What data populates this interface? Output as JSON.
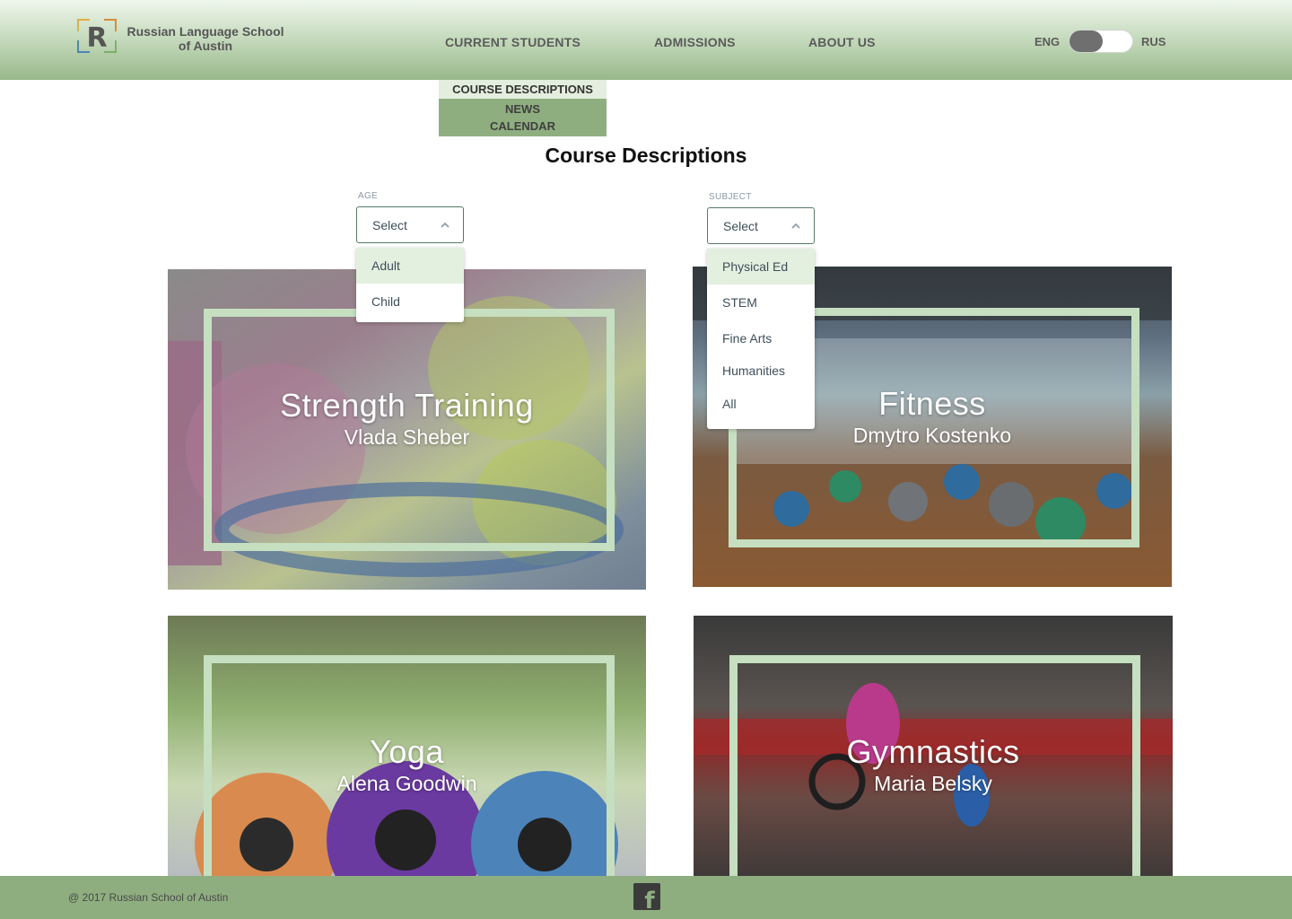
{
  "header": {
    "logo_letter": "R",
    "school_name_line1": "Russian Language School",
    "school_name_line2": "of Austin",
    "nav": {
      "current_students": "CURRENT STUDENTS",
      "admissions": "ADMISSIONS",
      "about_us": "ABOUT US"
    },
    "lang_eng": "ENG",
    "lang_rus": "RUS"
  },
  "submenu": {
    "items": [
      "COURSE DESCRIPTIONS",
      "NEWS",
      "CALENDAR"
    ]
  },
  "page_title": "Course Descriptions",
  "filters": {
    "age": {
      "label": "AGE",
      "value": "Select",
      "options": [
        "Adult",
        "Child"
      ]
    },
    "subject": {
      "label": "SUBJECT",
      "value": "Select",
      "options": [
        "Physical Ed",
        "STEM",
        "Fine Arts",
        "Humanities",
        "All"
      ]
    }
  },
  "courses": [
    {
      "title": "Strength Training",
      "instructor": "Vlada Sheber"
    },
    {
      "title": "Fitness",
      "instructor": "Dmytro Kostenko"
    },
    {
      "title": "Yoga",
      "instructor": "Alena Goodwin"
    },
    {
      "title": "Gymnastics",
      "instructor": "Maria Belsky"
    }
  ],
  "footer": {
    "copyright": "@ 2017 Russian School of Austin",
    "facebook_glyph": "f"
  },
  "colors": {
    "accent_green": "#8fae80",
    "frame_green": "#c5dfc0",
    "header_top": "#eef6ec"
  }
}
